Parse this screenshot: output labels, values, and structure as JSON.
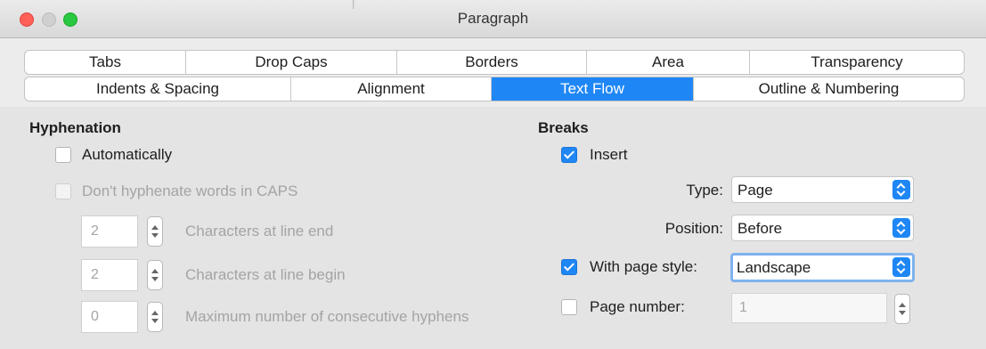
{
  "window": {
    "title": "Paragraph"
  },
  "tabs_row1": [
    "Tabs",
    "Drop Caps",
    "Borders",
    "Area",
    "Transparency"
  ],
  "tabs_row2": [
    "Indents & Spacing",
    "Alignment",
    "Text Flow",
    "Outline & Numbering"
  ],
  "active_tab": "Text Flow",
  "hyphenation": {
    "heading": "Hyphenation",
    "automatically": {
      "label": "Automatically",
      "checked": false
    },
    "caps": {
      "label": "Don't hyphenate words in CAPS",
      "checked": false,
      "enabled": false
    },
    "line_end": {
      "value": "2",
      "label": "Characters at line end"
    },
    "line_begin": {
      "value": "2",
      "label": "Characters at line begin"
    },
    "max_hyphens": {
      "value": "0",
      "label": "Maximum number of consecutive hyphens"
    }
  },
  "breaks": {
    "heading": "Breaks",
    "insert": {
      "label": "Insert",
      "checked": true
    },
    "type": {
      "label": "Type:",
      "value": "Page"
    },
    "position": {
      "label": "Position:",
      "value": "Before"
    },
    "page_style": {
      "label": "With page style:",
      "checked": true,
      "value": "Landscape"
    },
    "page_number": {
      "label": "Page number:",
      "checked": false,
      "value": "1"
    }
  },
  "colors": {
    "accent": "#1f87f5"
  }
}
